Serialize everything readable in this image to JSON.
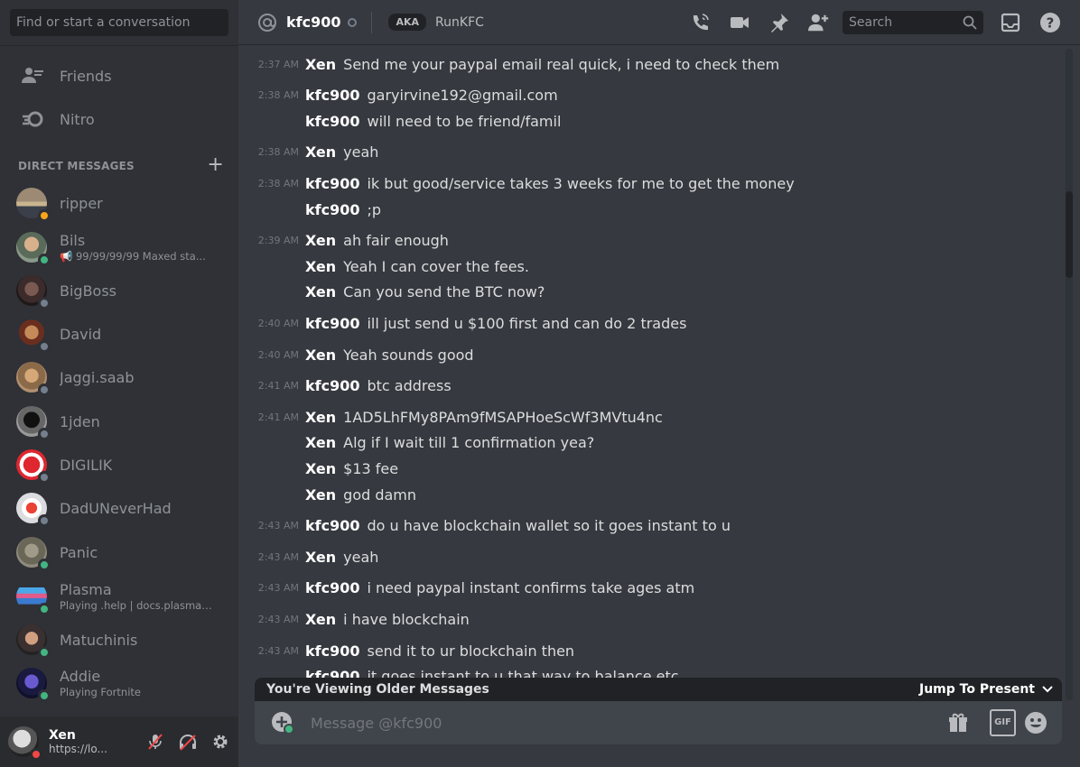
{
  "sidebar": {
    "search_placeholder": "Find or start a conversation",
    "nav": [
      {
        "label": "Friends",
        "icon": "friends-icon"
      },
      {
        "label": "Nitro",
        "icon": "nitro-icon"
      }
    ],
    "dm_header": "DIRECT MESSAGES",
    "dms": [
      {
        "name": "ripper",
        "sub": "",
        "status": "idle"
      },
      {
        "name": "Bils",
        "sub": "📢 99/99/99/99 Maxed sta...",
        "status": "online"
      },
      {
        "name": "BigBoss",
        "sub": "",
        "status": "offline"
      },
      {
        "name": "David",
        "sub": "",
        "status": "offline"
      },
      {
        "name": "Jaggi.saab",
        "sub": "",
        "status": "offline"
      },
      {
        "name": "1jden",
        "sub": "",
        "status": "offline"
      },
      {
        "name": "DIGILIK",
        "sub": "",
        "status": "offline"
      },
      {
        "name": "DadUNeverHad",
        "sub": "",
        "status": "offline"
      },
      {
        "name": "Panic",
        "sub": "",
        "status": "online"
      },
      {
        "name": "Plasma",
        "sub": "Playing .help | docs.plasmab...",
        "status": "online"
      },
      {
        "name": "Matuchinis",
        "sub": "",
        "status": "online"
      },
      {
        "name": "Addie",
        "sub": "Playing Fortnite",
        "status": "online"
      }
    ],
    "user": {
      "name": "Xen",
      "sub": "https://lo..."
    }
  },
  "header": {
    "channel": "kfc900",
    "aka_tag": "AKA",
    "aka_name": "RunKFC",
    "search_placeholder": "Search"
  },
  "messages": [
    {
      "time": "2:37 AM",
      "author": "Xen",
      "text": "Send me your paypal email  real quick, i need to check them"
    },
    {
      "time": "2:38 AM",
      "author": "kfc900",
      "text": "garyirvine192@gmail.com"
    },
    {
      "time": "",
      "author": "kfc900",
      "text": "will need to be friend/famil"
    },
    {
      "time": "2:38 AM",
      "author": "Xen",
      "text": "yeah"
    },
    {
      "time": "2:38 AM",
      "author": "kfc900",
      "text": "ik but good/service takes 3 weeks for me to get the money"
    },
    {
      "time": "",
      "author": "kfc900",
      "text": ";p"
    },
    {
      "time": "2:39 AM",
      "author": "Xen",
      "text": "ah fair enough"
    },
    {
      "time": "",
      "author": "Xen",
      "text": "Yeah I can cover the fees."
    },
    {
      "time": "",
      "author": "Xen",
      "text": "Can you send the BTC now?"
    },
    {
      "time": "2:40 AM",
      "author": "kfc900",
      "text": "ill just send u $100 first and can do 2 trades"
    },
    {
      "time": "2:40 AM",
      "author": "Xen",
      "text": "Yeah sounds good"
    },
    {
      "time": "2:41 AM",
      "author": "kfc900",
      "text": "btc address"
    },
    {
      "time": "2:41 AM",
      "author": "Xen",
      "text": "1AD5LhFMy8PAm9fMSAPHoeScWf3MVtu4nc"
    },
    {
      "time": "",
      "author": "Xen",
      "text": "Alg if I wait till 1 confirmation yea?"
    },
    {
      "time": "",
      "author": "Xen",
      "text": "$13 fee"
    },
    {
      "time": "",
      "author": "Xen",
      "text": "god damn"
    },
    {
      "time": "2:43 AM",
      "author": "kfc900",
      "text": "do u have blockchain wallet so it goes instant to u"
    },
    {
      "time": "2:43 AM",
      "author": "Xen",
      "text": "yeah"
    },
    {
      "time": "2:43 AM",
      "author": "kfc900",
      "text": "i need paypal instant confirms take ages atm"
    },
    {
      "time": "2:43 AM",
      "author": "Xen",
      "text": "i have blockchain"
    },
    {
      "time": "2:43 AM",
      "author": "kfc900",
      "text": "send it to ur blockchain then"
    },
    {
      "time": "",
      "author": "kfc900",
      "text": "it goes instant to u that way to balance etc"
    }
  ],
  "older_bar": {
    "text": "You're Viewing Older Messages",
    "jump": "Jump To Present"
  },
  "composer": {
    "placeholder": "Message @kfc900",
    "gif": "GIF"
  }
}
